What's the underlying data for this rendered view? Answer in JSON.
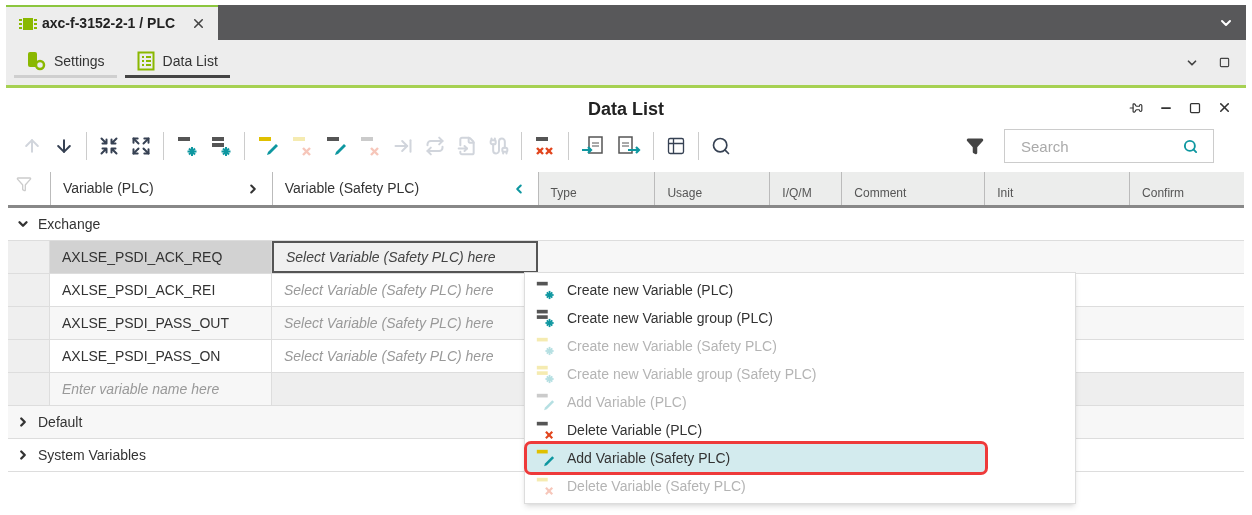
{
  "document_tab": {
    "title": "axc-f-3152-2-1 / PLC",
    "selected": true
  },
  "view_tabs": [
    {
      "label": "Settings",
      "kind": "settings",
      "selected": false
    },
    {
      "label": "Data List",
      "kind": "list",
      "selected": true
    }
  ],
  "panel": {
    "title": "Data List"
  },
  "toolbar": [
    {
      "kind": "up",
      "disabled": true
    },
    {
      "kind": "down",
      "disabled": false
    },
    {
      "kind": "sep"
    },
    {
      "kind": "collapse",
      "disabled": false
    },
    {
      "kind": "expand",
      "disabled": false
    },
    {
      "kind": "sep"
    },
    {
      "kind": "var-new",
      "disabled": false
    },
    {
      "kind": "var-group-new",
      "disabled": false
    },
    {
      "kind": "sep"
    },
    {
      "kind": "var-add-safety",
      "disabled": false
    },
    {
      "kind": "var-delete-safety",
      "disabled": true
    },
    {
      "kind": "hmi-add",
      "disabled": false
    },
    {
      "kind": "hmi-delete",
      "disabled": true
    },
    {
      "kind": "link",
      "disabled": true
    },
    {
      "kind": "swap",
      "disabled": true
    },
    {
      "kind": "import",
      "disabled": true
    },
    {
      "kind": "connect",
      "disabled": true
    },
    {
      "kind": "sep"
    },
    {
      "kind": "var-delete-all",
      "disabled": false
    },
    {
      "kind": "sep"
    },
    {
      "kind": "csv-import",
      "disabled": false
    },
    {
      "kind": "csv-export",
      "disabled": false
    },
    {
      "kind": "sep"
    },
    {
      "kind": "table",
      "disabled": false
    },
    {
      "kind": "sep"
    },
    {
      "kind": "find",
      "disabled": false
    }
  ],
  "search": {
    "placeholder": "Search"
  },
  "table": {
    "columns": [
      {
        "label": "Variable (PLC)",
        "kind": "plc"
      },
      {
        "label": "Variable (Safety PLC)",
        "kind": "safety"
      },
      {
        "label": "Type",
        "kind": "plain"
      },
      {
        "label": "Usage",
        "kind": "plain"
      },
      {
        "label": "I/Q/M",
        "kind": "plain"
      },
      {
        "label": "Comment",
        "kind": "plain"
      },
      {
        "label": "Init",
        "kind": "plain"
      },
      {
        "label": "Confirm",
        "kind": "plain"
      }
    ],
    "groups": [
      {
        "name": "Exchange",
        "expanded": true,
        "rows": [
          {
            "kind": "variable",
            "plc": "AXLSE_PSDI_ACK_REQ",
            "safety": "Select Variable (Safety PLC) here",
            "selected": true
          },
          {
            "kind": "variable",
            "plc": "AXLSE_PSDI_ACK_REI",
            "safety": "Select Variable (Safety PLC) here",
            "selected": false
          },
          {
            "kind": "variable",
            "plc": "AXLSE_PSDI_PASS_OUT",
            "safety": "Select Variable (Safety PLC) here",
            "selected": false
          },
          {
            "kind": "variable",
            "plc": "AXLSE_PSDI_PASS_ON",
            "safety": "Select Variable (Safety PLC) here",
            "selected": false
          },
          {
            "kind": "new",
            "placeholder": "Enter variable name here"
          }
        ]
      },
      {
        "name": "Default",
        "expanded": false
      },
      {
        "name": "System Variables",
        "expanded": false
      }
    ]
  },
  "context_menu": [
    {
      "label": "Create new Variable (PLC)",
      "kind": "new",
      "safety": false,
      "disabled": false,
      "selected": false,
      "outlined": false
    },
    {
      "label": "Create new Variable group (PLC)",
      "kind": "group",
      "safety": false,
      "disabled": false,
      "selected": false,
      "outlined": false
    },
    {
      "label": "Create new Variable (Safety PLC)",
      "kind": "new",
      "safety": true,
      "disabled": true,
      "selected": false,
      "outlined": false
    },
    {
      "label": "Create new Variable group (Safety PLC)",
      "kind": "group",
      "safety": true,
      "disabled": true,
      "selected": false,
      "outlined": false
    },
    {
      "label": "Add Variable (PLC)",
      "kind": "add",
      "safety": false,
      "disabled": true,
      "selected": false,
      "outlined": false
    },
    {
      "label": "Delete Variable (PLC)",
      "kind": "delete",
      "safety": false,
      "disabled": false,
      "selected": false,
      "outlined": false
    },
    {
      "label": "Add Variable (Safety PLC)",
      "kind": "add",
      "safety": true,
      "disabled": false,
      "selected": true,
      "outlined": true
    },
    {
      "label": "Delete Variable (Safety PLC)",
      "kind": "delete",
      "safety": true,
      "disabled": true,
      "selected": false,
      "outlined": false
    }
  ]
}
